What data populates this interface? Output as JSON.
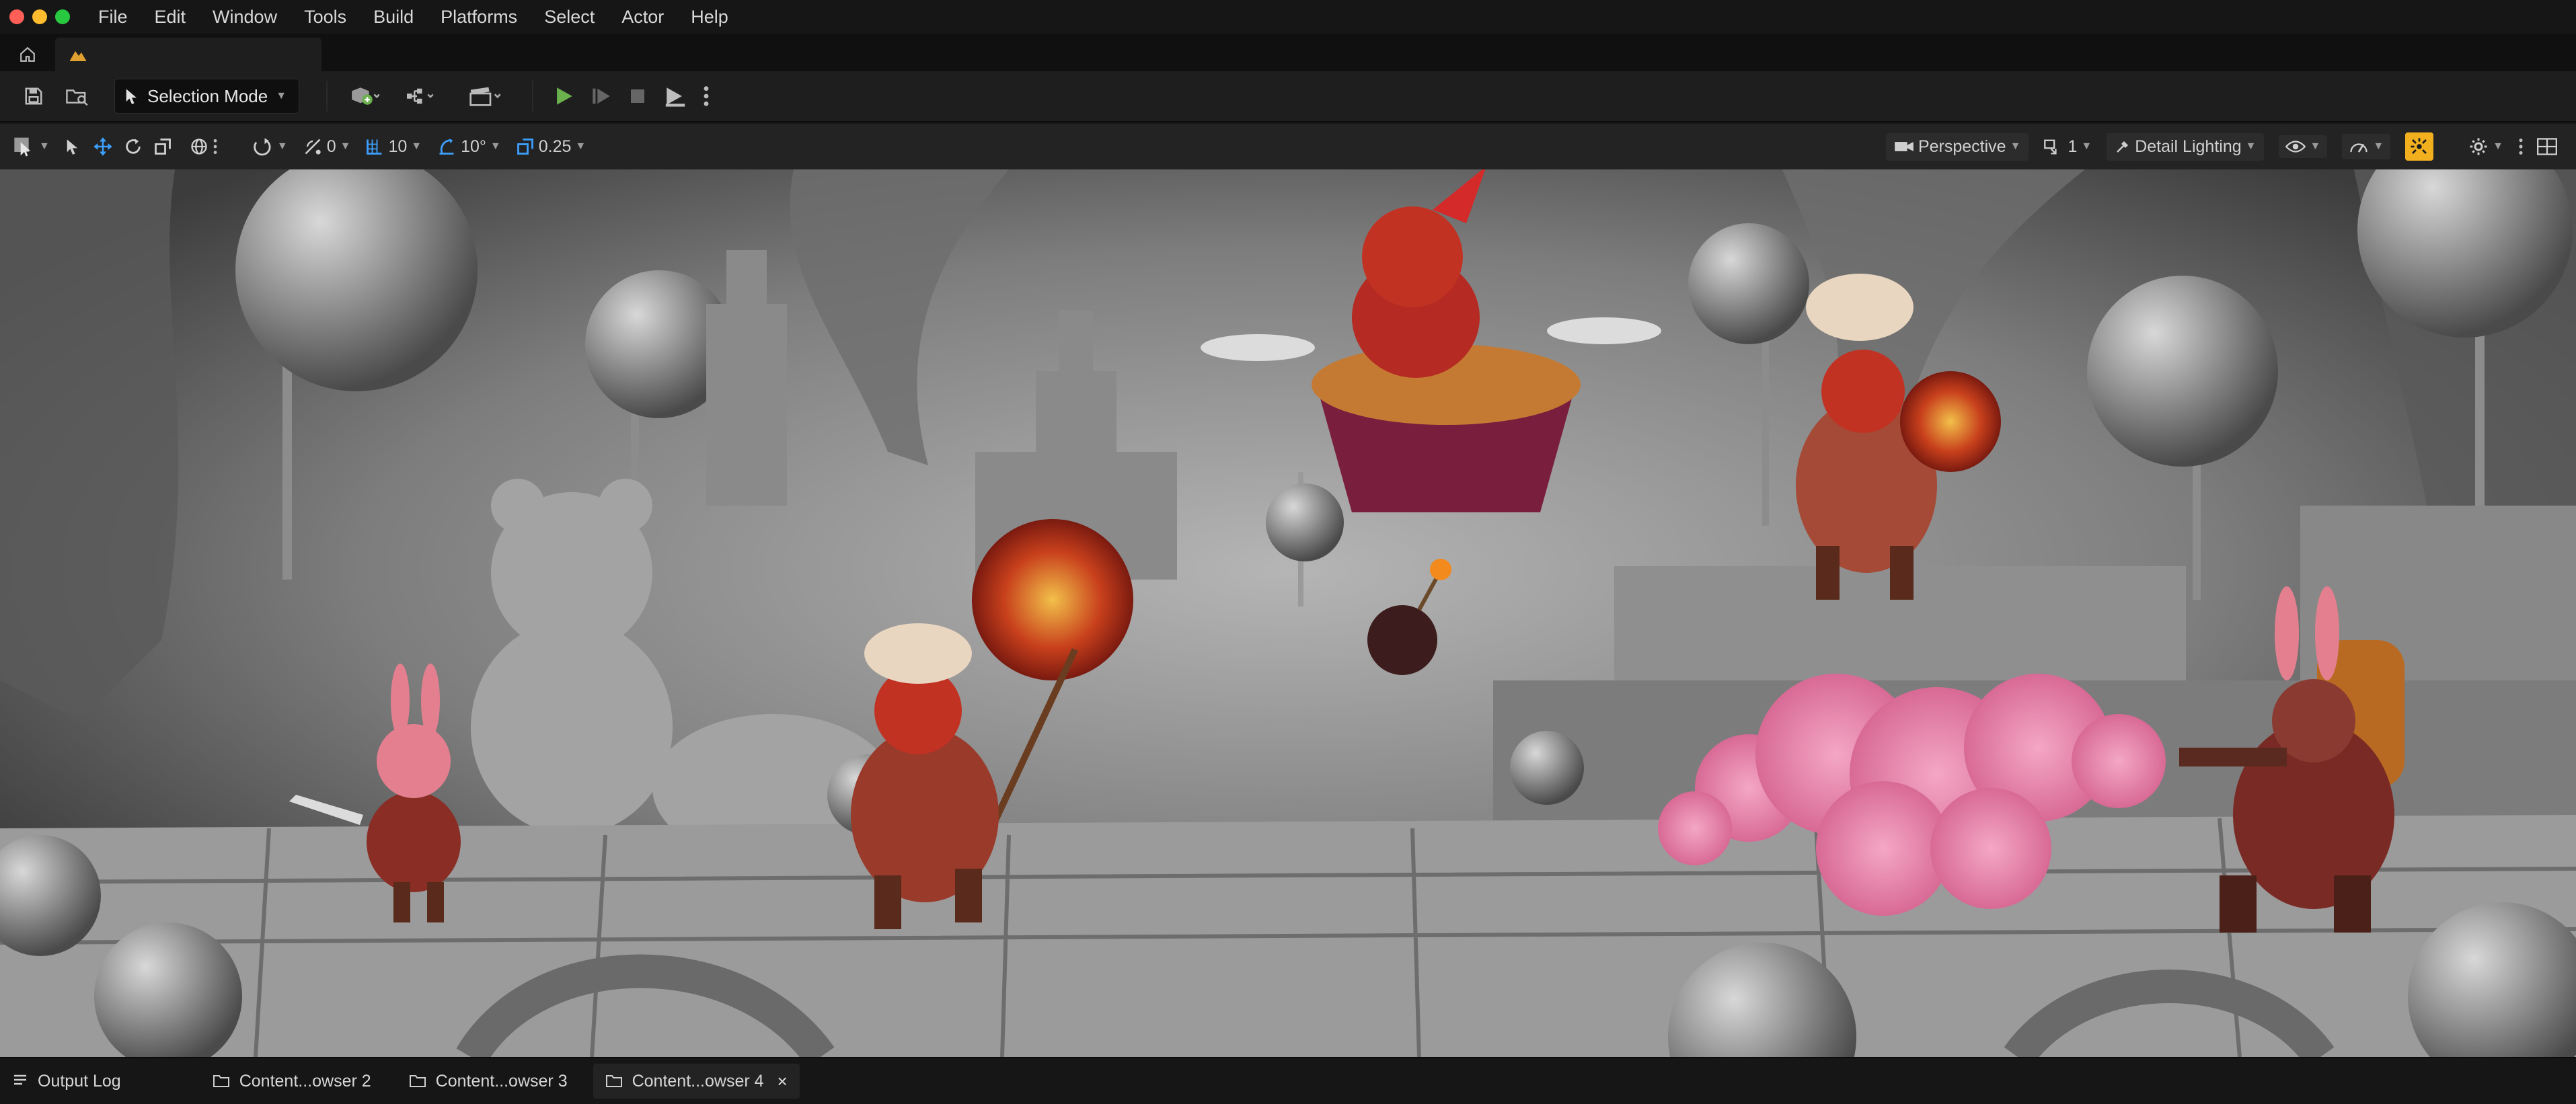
{
  "window": {
    "traffic_lights": [
      "#ff5f57",
      "#febc2e",
      "#28c840"
    ]
  },
  "menu": {
    "items": [
      "File",
      "Edit",
      "Window",
      "Tools",
      "Build",
      "Platforms",
      "Select",
      "Actor",
      "Help"
    ]
  },
  "tabs": {
    "home_icon": "home-icon",
    "level_icon": "level-icon"
  },
  "toolbar": {
    "selection_mode": "Selection Mode",
    "colors": {
      "play": "#6ab04c",
      "accent": "#f2b01e"
    }
  },
  "viewport_toolbar": {
    "rotate_snap_value": "0",
    "grid_snap_value": "10",
    "angle_snap_value": "10°",
    "scale_snap_value": "0.25",
    "perspective": "Perspective",
    "camera_speed": "1",
    "view_mode": "Detail Lighting"
  },
  "statusbar": {
    "output_log": "Output Log",
    "content_browser_2": "Content...owser 2",
    "content_browser_3": "Content...owser 3",
    "content_browser_4": "Content...owser 4",
    "close_glyph": "×"
  }
}
